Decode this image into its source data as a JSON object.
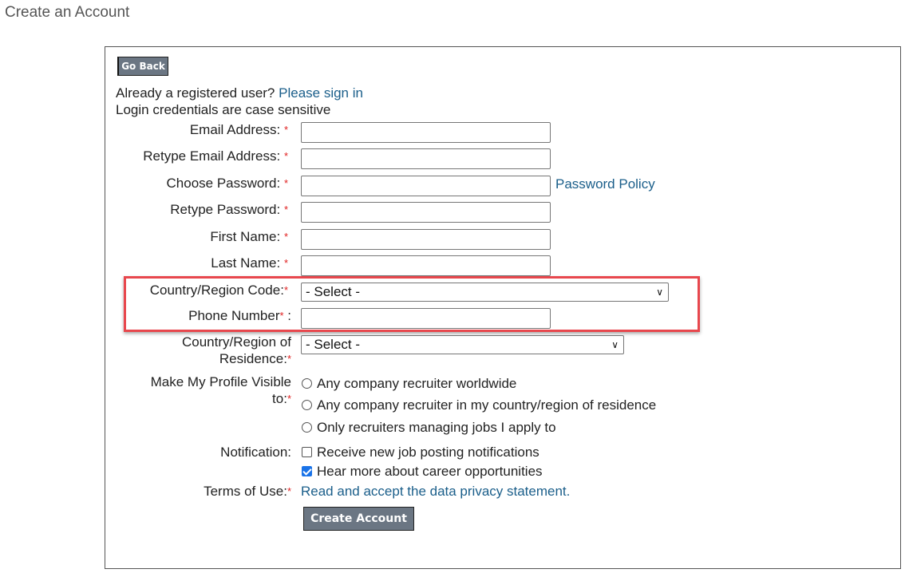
{
  "page": {
    "title": "Create an Account"
  },
  "form": {
    "go_back_label": "Go Back",
    "registered_prompt": "Already a registered user?",
    "sign_in_link": "Please sign in",
    "case_note": "Login credentials are case sensitive",
    "required_marker": "*",
    "fields": {
      "email": {
        "label": "Email Address:",
        "value": ""
      },
      "retype_email": {
        "label": "Retype Email Address:",
        "value": ""
      },
      "password": {
        "label": "Choose Password:",
        "value": ""
      },
      "retype_password": {
        "label": "Retype Password:",
        "value": ""
      },
      "first_name": {
        "label": "First Name:",
        "value": ""
      },
      "last_name": {
        "label": "Last Name:",
        "value": ""
      },
      "country_code": {
        "label": "Country/Region Code:",
        "value": "- Select -"
      },
      "phone": {
        "label": "Phone Number",
        "suffix": " :",
        "value": ""
      },
      "residence": {
        "label_line1": "Country/Region of",
        "label_line2": "Residence:",
        "value": "- Select -"
      }
    },
    "password_policy_link": "Password Policy",
    "visibility": {
      "label_line1": "Make My Profile Visible",
      "label_line2": "to:",
      "options": [
        {
          "label": "Any company recruiter worldwide",
          "selected": false
        },
        {
          "label": "Any company recruiter in my country/region of residence",
          "selected": false
        },
        {
          "label": "Only recruiters managing jobs I apply to",
          "selected": false
        }
      ]
    },
    "notification": {
      "label": "Notification:",
      "options": [
        {
          "label": "Receive new job posting notifications",
          "checked": false
        },
        {
          "label": "Hear more about career opportunities",
          "checked": true
        }
      ]
    },
    "terms": {
      "label": "Terms of Use:",
      "link": "Read and accept the data privacy statement."
    },
    "create_account_label": "Create Account"
  },
  "colors": {
    "link": "#1a5e8a",
    "required": "#e02020",
    "highlight": "#e8474d",
    "button": "#6b7683"
  }
}
